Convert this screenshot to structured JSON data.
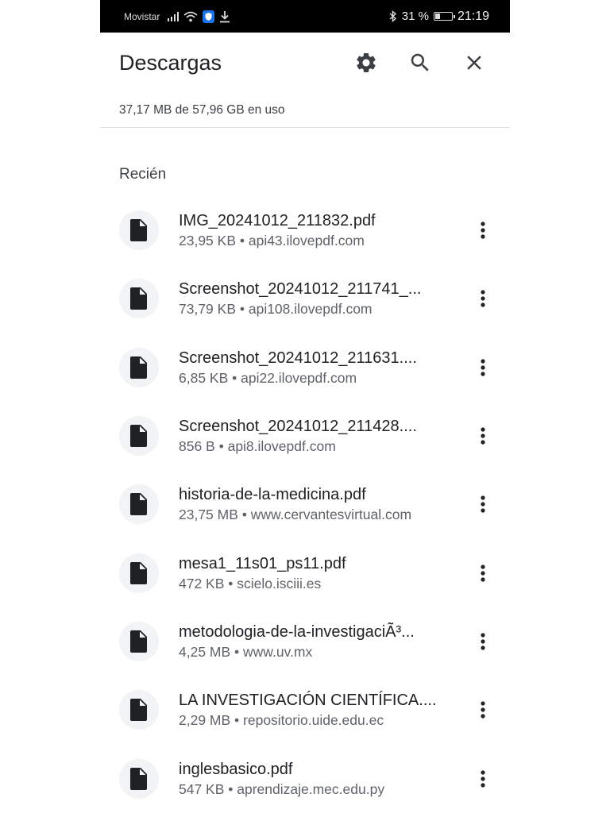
{
  "status_bar": {
    "carrier": "Movistar",
    "battery_percent": "31 %",
    "battery_level": 0.31,
    "time": "21:19",
    "icons": [
      "signal-icon",
      "wifi-icon",
      "shield-icon",
      "download-icon",
      "bluetooth-icon",
      "battery-icon"
    ]
  },
  "app_bar": {
    "title": "Descargas",
    "actions": [
      "settings-icon",
      "search-icon",
      "close-icon"
    ]
  },
  "storage_info": "37,17 MB de 57,96 GB en uso",
  "section_title": "Recién",
  "files": [
    {
      "name": "IMG_20241012_211832.pdf",
      "meta": "23,95 KB • api43.ilovepdf.com"
    },
    {
      "name": "Screenshot_20241012_211741_...",
      "meta": "73,79 KB • api108.ilovepdf.com"
    },
    {
      "name": "Screenshot_20241012_211631....",
      "meta": "6,85 KB • api22.ilovepdf.com"
    },
    {
      "name": "Screenshot_20241012_211428....",
      "meta": "856 B • api8.ilovepdf.com"
    },
    {
      "name": "historia-de-la-medicina.pdf",
      "meta": "23,75 MB • www.cervantesvirtual.com"
    },
    {
      "name": "mesa1_11s01_ps11.pdf",
      "meta": "472 KB • scielo.isciii.es"
    },
    {
      "name": "metodologia-de-la-investigaciÃ³...",
      "meta": "4,25 MB • www.uv.mx"
    },
    {
      "name": "LA INVESTIGACIÓN CIENTÍFICA....",
      "meta": "2,29 MB • repositorio.uide.edu.ec"
    },
    {
      "name": "inglesbasico.pdf",
      "meta": "547 KB • aprendizaje.mec.edu.py"
    }
  ]
}
